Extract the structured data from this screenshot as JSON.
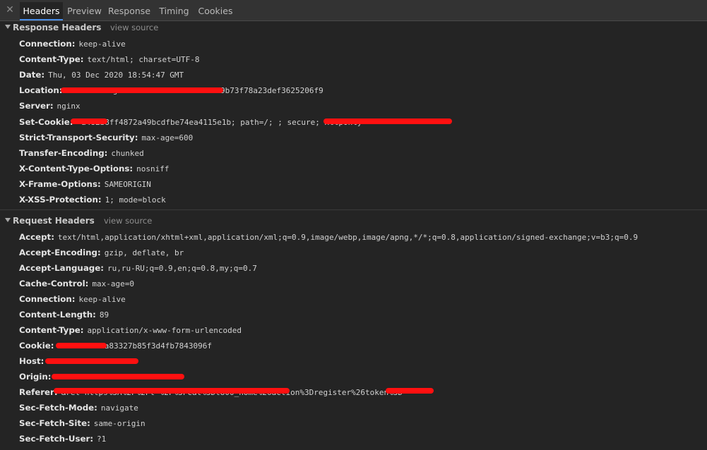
{
  "colors": {
    "background": "#242424",
    "tabbar": "#333333",
    "active_tab_underline": "#4a8ee8",
    "redaction": "#ff1010"
  },
  "tabs": [
    {
      "label": "Headers",
      "active": true
    },
    {
      "label": "Preview",
      "active": false
    },
    {
      "label": "Response",
      "active": false
    },
    {
      "label": "Timing",
      "active": false
    },
    {
      "label": "Cookies",
      "active": false
    }
  ],
  "close_icon": "close-icon",
  "response_headers": {
    "title": "Response Headers",
    "view_source": "view source",
    "rows": [
      {
        "name": "Connection:",
        "value": "keep-alive"
      },
      {
        "name": "Content-Type:",
        "value": "text/html; charset=UTF-8"
      },
      {
        "name": "Date:",
        "value": "Thu, 03 Dec 2020 18:54:47 GMT"
      },
      {
        "name": "Location:",
        "value": "&action=register&token=b5c7c5db029b73f78a23def3625206f9"
      },
      {
        "name": "Server:",
        "value": "nginx"
      },
      {
        "name": "Set-Cookie:",
        "value": "=a482b8ff4872a49bcdfbe74ea4115e1b; path=/;                          ; secure; HttpOnly"
      },
      {
        "name": "Strict-Transport-Security:",
        "value": "max-age=600"
      },
      {
        "name": "Transfer-Encoding:",
        "value": "chunked"
      },
      {
        "name": "X-Content-Type-Options:",
        "value": "nosniff"
      },
      {
        "name": "X-Frame-Options:",
        "value": "SAMEORIGIN"
      },
      {
        "name": "X-XSS-Protection:",
        "value": "1; mode=block"
      }
    ]
  },
  "request_headers": {
    "title": "Request Headers",
    "view_source": "view source",
    "rows": [
      {
        "name": "Accept:",
        "value": "text/html,application/xhtml+xml,application/xml;q=0.9,image/webp,image/apng,*/*;q=0.8,application/signed-exchange;v=b3;q=0.9"
      },
      {
        "name": "Accept-Encoding:",
        "value": "gzip, deflate, br"
      },
      {
        "name": "Accept-Language:",
        "value": "ru,ru-RU;q=0.9,en;q=0.8,my;q=0.7"
      },
      {
        "name": "Cache-Control:",
        "value": "max-age=0"
      },
      {
        "name": "Connection:",
        "value": "keep-alive"
      },
      {
        "name": "Content-Length:",
        "value": "89"
      },
      {
        "name": "Content-Type:",
        "value": "application/x-www-form-urlencoded"
      },
      {
        "name": "Cookie:",
        "value": "=9eab9b03ea83327b85f3d4fb7843096f"
      },
      {
        "name": "Host:",
        "value": ""
      },
      {
        "name": "Origin:",
        "value": ""
      },
      {
        "name": "Referer:",
        "value": "&ret=https%3A%2F%2Ft          %2F%3Fcat%3Dt800_home%26action%3Dregister%26token%3D"
      },
      {
        "name": "Sec-Fetch-Mode:",
        "value": "navigate"
      },
      {
        "name": "Sec-Fetch-Site:",
        "value": "same-origin"
      },
      {
        "name": "Sec-Fetch-User:",
        "value": "?1"
      }
    ]
  }
}
